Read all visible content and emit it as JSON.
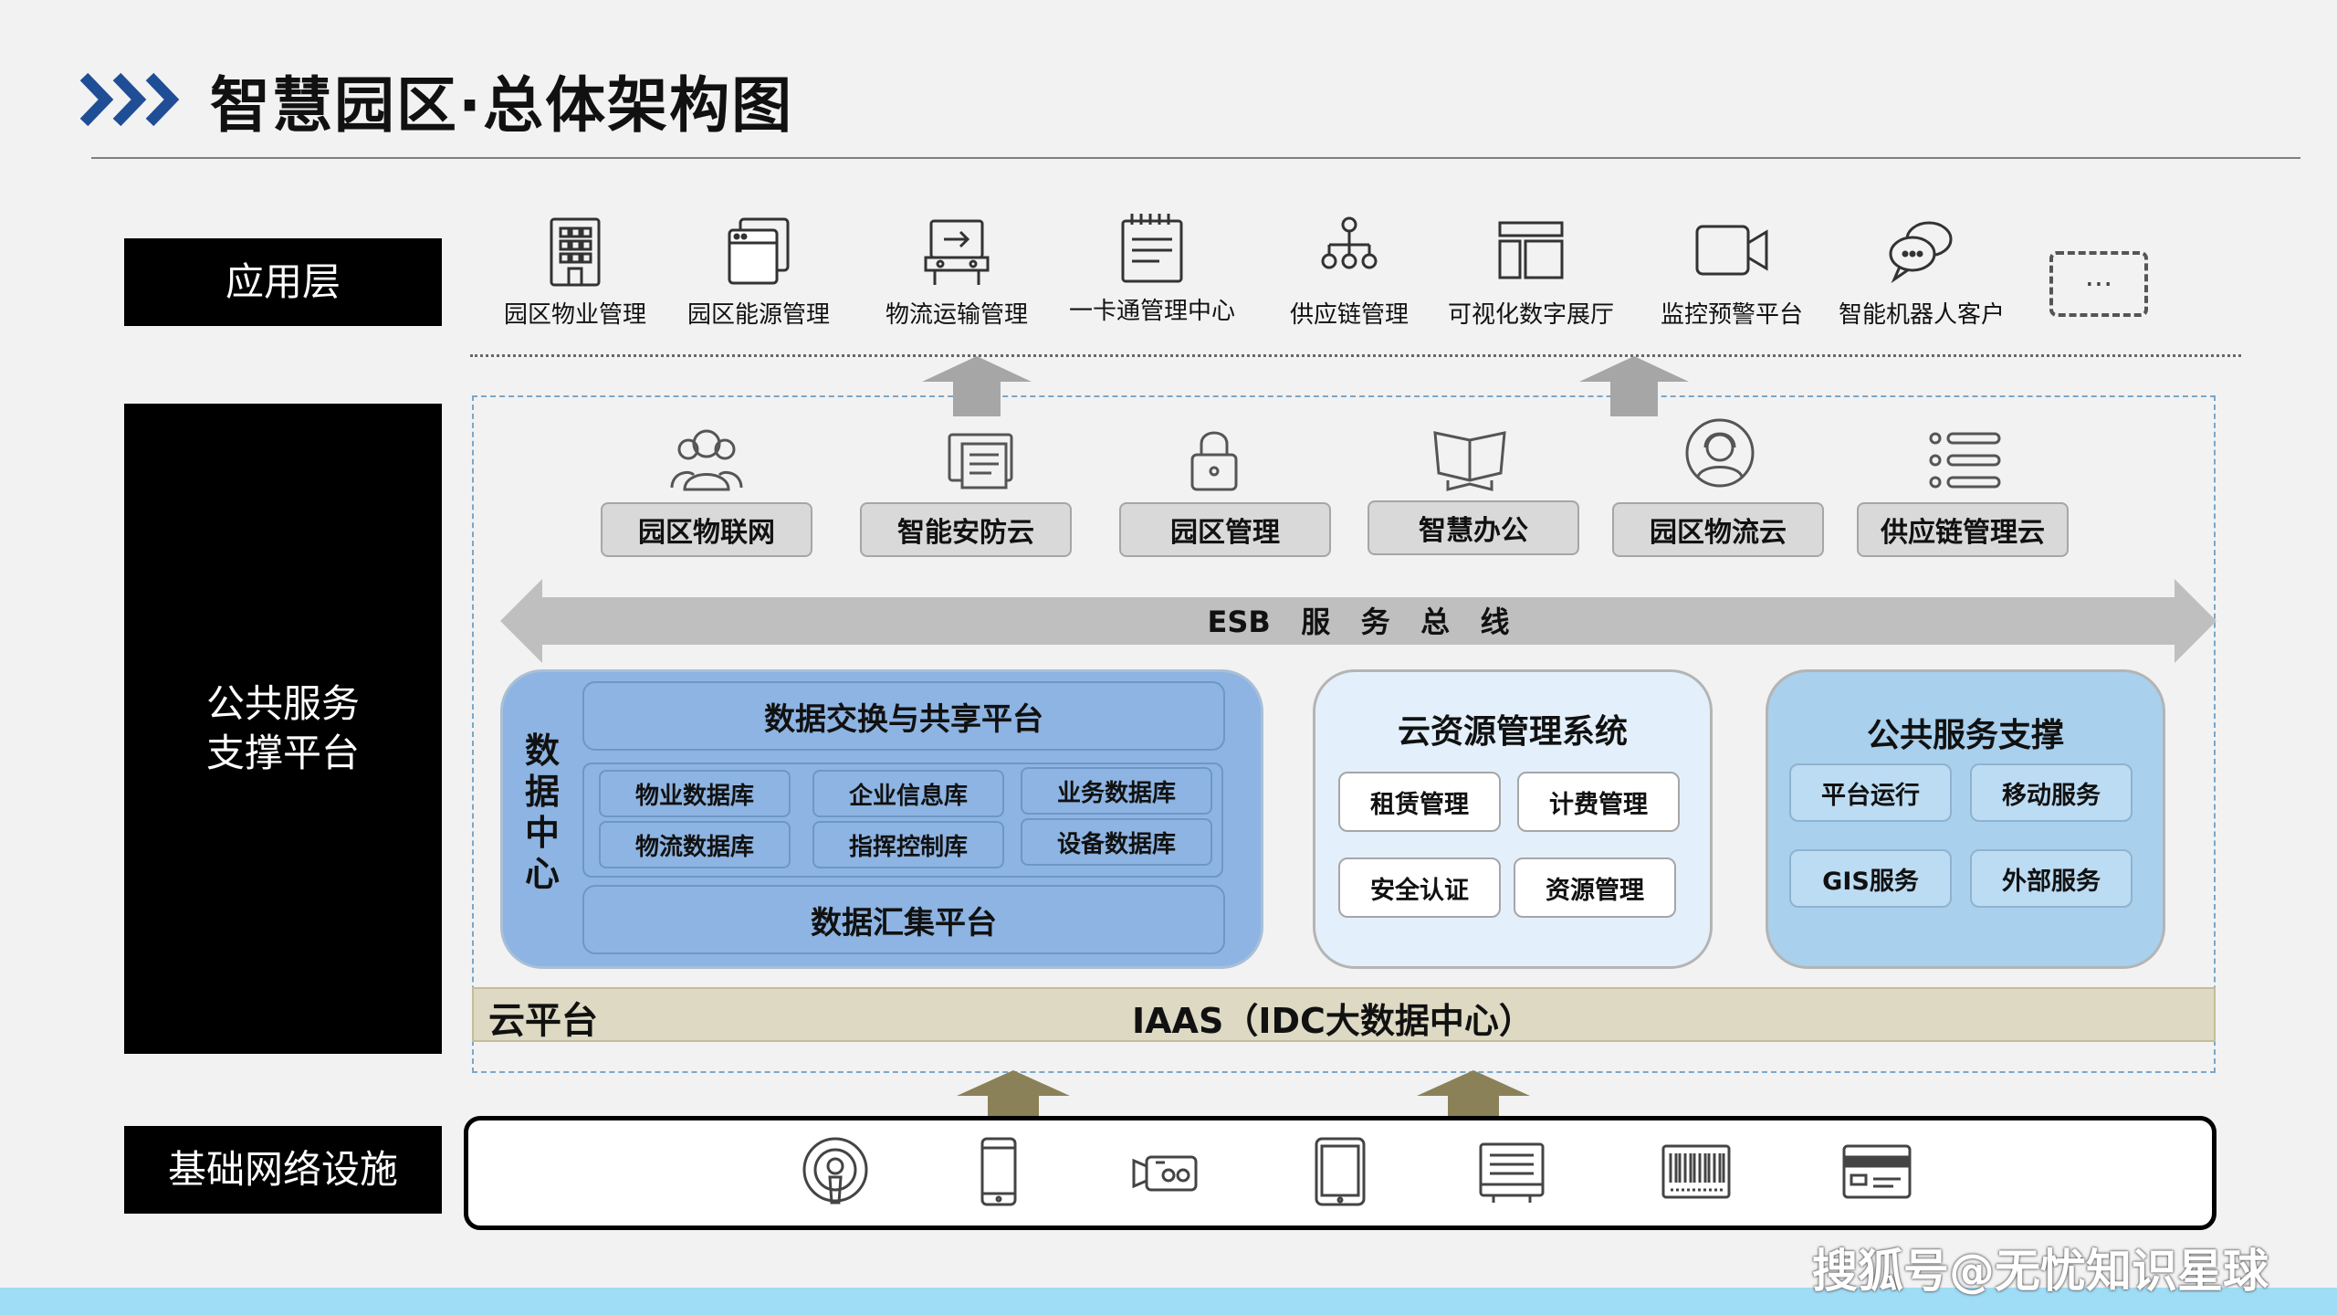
{
  "page": {
    "title": "智慧园区·总体架构图",
    "watermark": "搜狐号@无忧知识星球"
  },
  "layers": {
    "application": "应用层",
    "public": "公共服务\n支撑平台",
    "infrastructure": "基础网络设施"
  },
  "applications": [
    {
      "label": "园区物业管理",
      "icon": "building-icon"
    },
    {
      "label": "园区能源管理",
      "icon": "window-stack-icon"
    },
    {
      "label": "物流运输管理",
      "icon": "truck-sign-icon"
    },
    {
      "label": "一卡通管理中心",
      "icon": "notepad-icon"
    },
    {
      "label": "供应链管理",
      "icon": "org-chart-icon"
    },
    {
      "label": "可视化数字展厅",
      "icon": "layout-icon"
    },
    {
      "label": "监控预警平台",
      "icon": "video-camera-icon"
    },
    {
      "label": "智能机器人客户",
      "icon": "chat-bubbles-icon"
    }
  ],
  "app_more": "···",
  "services": [
    {
      "label": "园区物联网",
      "icon": "users-icon"
    },
    {
      "label": "智能安防云",
      "icon": "monitor-doc-icon"
    },
    {
      "label": "园区管理",
      "icon": "lock-icon"
    },
    {
      "label": "智慧办公",
      "icon": "book-icon"
    },
    {
      "label": "园区物流云",
      "icon": "headset-user-icon"
    },
    {
      "label": "供应链管理云",
      "icon": "list-icon"
    }
  ],
  "esb": "ESB   服   务   总   线",
  "data_center": {
    "label": "数据中心",
    "exchange": "数据交换与共享平台",
    "databases": [
      "物业数据库",
      "企业信息库",
      "业务数据库",
      "物流数据库",
      "指挥控制库",
      "设备数据库"
    ],
    "collection": "数据汇集平台"
  },
  "cloud_mgmt": {
    "title": "云资源管理系统",
    "items": [
      "租赁管理",
      "计费管理",
      "安全认证",
      "资源管理"
    ]
  },
  "public_support": {
    "title": "公共服务支撑",
    "items": [
      "平台运行",
      "移动服务",
      "GIS服务",
      "外部服务"
    ]
  },
  "cloud_platform": {
    "left": "云平台",
    "center": "IAAS（IDC大数据中心）"
  },
  "infrastructure_icons": [
    "podcast-icon",
    "smartphone-icon",
    "cctv-camera-icon",
    "tablet-icon",
    "printer-terminal-icon",
    "barcode-icon",
    "card-reader-icon"
  ],
  "colors": {
    "data_block": "#8db4e2",
    "cloud_block": "#e3f0fb",
    "public_block": "#a9d0ec",
    "cloud_bar": "#ddd9c3",
    "arrow_gray": "#a6a6a6",
    "arrow_olive": "#8b8158",
    "title_arrows": "#1f4e96",
    "bottom_bar": "#9fdcf5"
  }
}
